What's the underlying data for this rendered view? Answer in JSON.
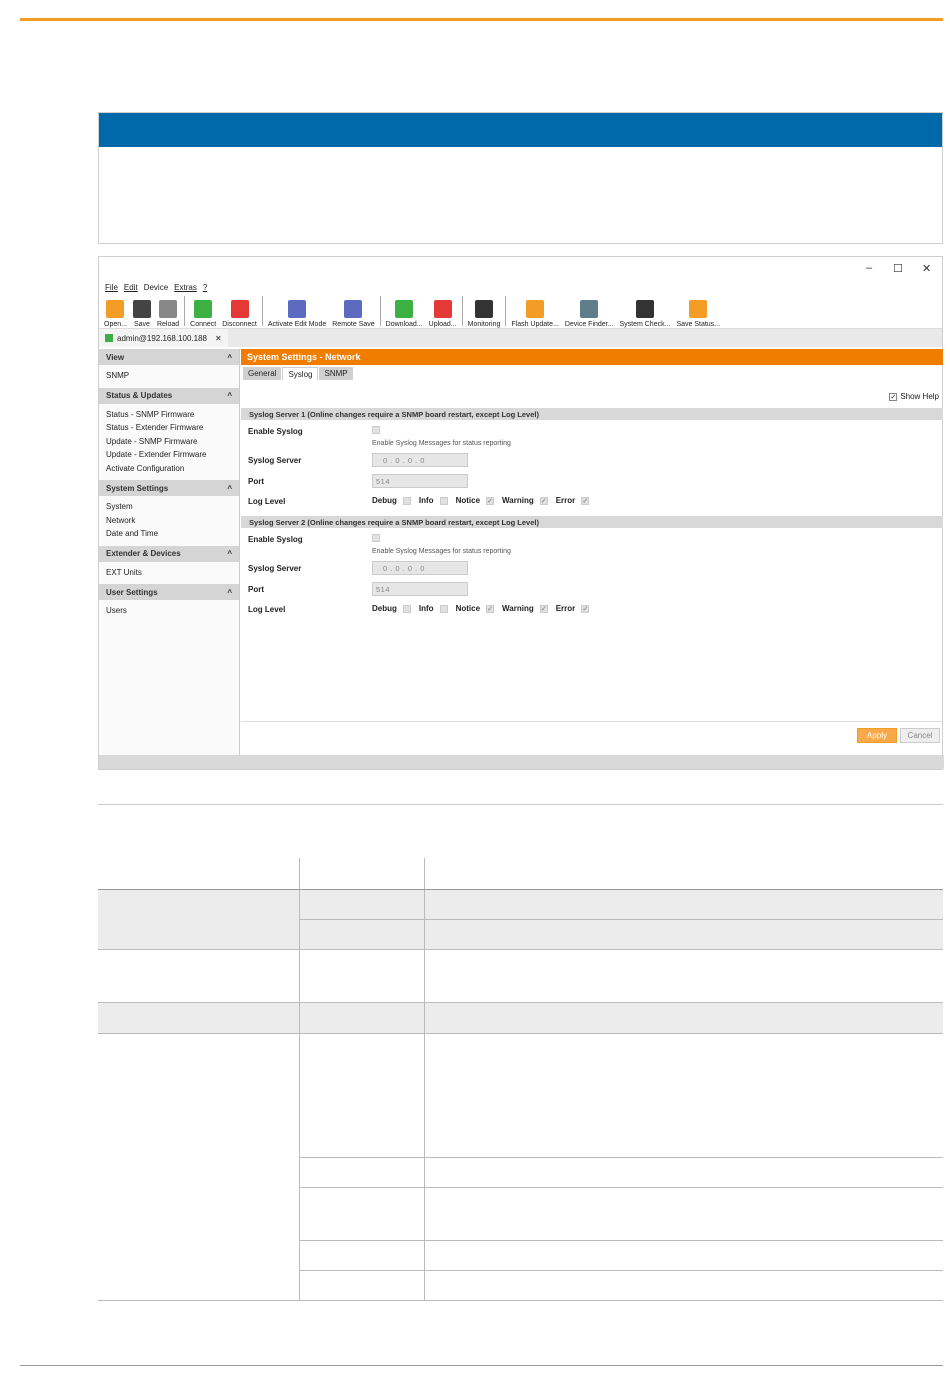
{
  "window": {
    "min": "–",
    "max": "☐",
    "close": "✕"
  },
  "menu": [
    "File",
    "Edit",
    "Device",
    "Extras",
    "?"
  ],
  "toolbar": [
    {
      "label": "Open...",
      "color": "#f39c26",
      "icon": "folder-icon"
    },
    {
      "label": "Save",
      "color": "#444444",
      "icon": "save-icon"
    },
    {
      "label": "Reload",
      "color": "#888888",
      "icon": "reload-icon"
    },
    {
      "label": "Connect",
      "color": "#3cb043",
      "icon": "connect-icon"
    },
    {
      "label": "Disconnect",
      "color": "#e53935",
      "icon": "disconnect-icon"
    },
    {
      "label": "Activate Edit Mode",
      "color": "#5c6bc0",
      "icon": "edit-mode-icon"
    },
    {
      "label": "Remote Save",
      "color": "#5c6bc0",
      "icon": "remote-save-icon"
    },
    {
      "label": "Download...",
      "color": "#3cb043",
      "icon": "download-icon"
    },
    {
      "label": "Upload...",
      "color": "#e53935",
      "icon": "upload-icon"
    },
    {
      "label": "Monitoring",
      "color": "#333333",
      "icon": "monitoring-icon"
    },
    {
      "label": "Flash Update...",
      "color": "#f39c26",
      "icon": "flash-update-icon"
    },
    {
      "label": "Device Finder...",
      "color": "#607d8b",
      "icon": "device-finder-icon"
    },
    {
      "label": "System Check...",
      "color": "#333333",
      "icon": "system-check-icon"
    },
    {
      "label": "Save Status...",
      "color": "#f39c26",
      "icon": "save-status-icon"
    }
  ],
  "device_tab": {
    "label": "admin@192.168.100.188",
    "close": "✕"
  },
  "sidebar": {
    "sections": [
      {
        "title": "View",
        "items": [
          "SNMP"
        ]
      },
      {
        "title": "Status & Updates",
        "items": [
          "Status - SNMP Firmware",
          "Status - Extender Firmware",
          "Update - SNMP Firmware",
          "Update - Extender Firmware",
          "Activate Configuration"
        ]
      },
      {
        "title": "System Settings",
        "items": [
          "System",
          "Network",
          "Date and Time"
        ]
      },
      {
        "title": "Extender & Devices",
        "items": [
          "EXT Units"
        ]
      },
      {
        "title": "User Settings",
        "items": [
          "Users"
        ]
      }
    ],
    "chevron": "^"
  },
  "main": {
    "title": "System Settings - Network",
    "tabs": [
      "General",
      "Syslog",
      "SNMP"
    ],
    "show_help": "Show Help",
    "servers": [
      {
        "head": "Syslog Server 1 (Online changes require a SNMP board restart, except Log Level)",
        "enable_label": "Enable Syslog",
        "help": "Enable Syslog Messages for status reporting",
        "server_label": "Syslog Server",
        "server_value": "0 . 0 . 0 . 0",
        "port_label": "Port",
        "port_value": "514",
        "level_label": "Log Level",
        "levels": [
          "Debug",
          "Info",
          "Notice",
          "Warning",
          "Error"
        ],
        "checked": [
          false,
          false,
          true,
          true,
          true
        ]
      },
      {
        "head": "Syslog Server 2 (Online changes require a SNMP board restart, except Log Level)",
        "enable_label": "Enable Syslog",
        "help": "Enable Syslog Messages for status reporting",
        "server_label": "Syslog Server",
        "server_value": "0 . 0 . 0 . 0",
        "port_label": "Port",
        "port_value": "514",
        "level_label": "Log Level",
        "levels": [
          "Debug",
          "Info",
          "Notice",
          "Warning",
          "Error"
        ],
        "checked": [
          false,
          false,
          true,
          true,
          true
        ]
      }
    ],
    "apply": "Apply",
    "cancel": "Cancel"
  }
}
